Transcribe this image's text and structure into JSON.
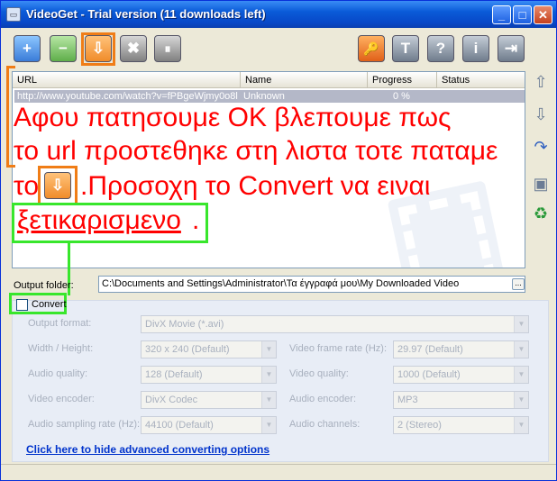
{
  "window": {
    "title": "VideoGet - Trial version (11 downloads left)",
    "minimize_glyph": "_",
    "maximize_glyph": "□",
    "close_glyph": "✕",
    "app_icon_glyph": "▭"
  },
  "toolbar": {
    "add_glyph": "+",
    "remove_glyph": "−",
    "download_glyph": "⇩",
    "stop_glyph": "✖",
    "pause_glyph": "⏸",
    "register_glyph": "🔑",
    "options_glyph": "T",
    "help_glyph": "?",
    "info_glyph": "i",
    "exit_glyph": "⇥",
    "icons": [
      "add-icon",
      "remove-icon",
      "download-icon",
      "stop-icon",
      "pause-icon",
      "key-icon",
      "settings-icon",
      "help-icon",
      "info-icon",
      "exit-icon"
    ]
  },
  "list": {
    "columns": [
      "URL",
      "Name",
      "Progress",
      "Status"
    ],
    "rows": [
      {
        "url": "http://www.youtube.com/watch?v=fPBgeWjmy0o8l",
        "name": "Unknown",
        "progress": "0 %",
        "status": ""
      }
    ]
  },
  "side_buttons": {
    "up_glyph": "⇧",
    "down_glyph": "⇩",
    "clear_glyph": "↷",
    "save_glyph": "▣",
    "recycle_glyph": "♻"
  },
  "annotation": {
    "line1": "Αφου πατησουμε ΟΚ βλεπουμε πως",
    "line2": "το url προστεθηκε στη λιστα τοτε παταμε",
    "line3_prefix": "το",
    "line3_suffix": ".Προσοχη το Convert να ειναι",
    "line4_word": "ξετικαρισμενο",
    "line4_suffix": ".",
    "color": "#ff0000"
  },
  "output": {
    "label": "Output folder:",
    "value": "C:\\Documents and Settings\\Administrator\\Τα έγγραφά μου\\My Downloaded Video",
    "browse_glyph": "..."
  },
  "convert": {
    "label": "Convert",
    "checked": false,
    "fields": {
      "output_format_label": "Output format:",
      "output_format_value": "DivX Movie (*.avi)",
      "width_height_label": "Width / Height:",
      "width_height_value": "320 x 240 (Default)",
      "video_frame_rate_label": "Video frame rate (Hz):",
      "video_frame_rate_value": "29.97 (Default)",
      "audio_quality_label": "Audio quality:",
      "audio_quality_value": "128 (Default)",
      "video_quality_label": "Video quality:",
      "video_quality_value": "1000 (Default)",
      "video_encoder_label": "Video encoder:",
      "video_encoder_value": "DivX Codec",
      "audio_encoder_label": "Audio encoder:",
      "audio_encoder_value": "MP3",
      "audio_sampling_label": "Audio sampling rate (Hz):",
      "audio_sampling_value": "44100 (Default)",
      "audio_channels_label": "Audio channels:",
      "audio_channels_value": "2 (Stereo)"
    },
    "link": "Click here to hide advanced converting options",
    "dropdown_glyph": "▼"
  },
  "colors": {
    "highlight_orange": "#f07d16",
    "highlight_green": "#38e62c",
    "title_bar": "#0a5bd8"
  }
}
